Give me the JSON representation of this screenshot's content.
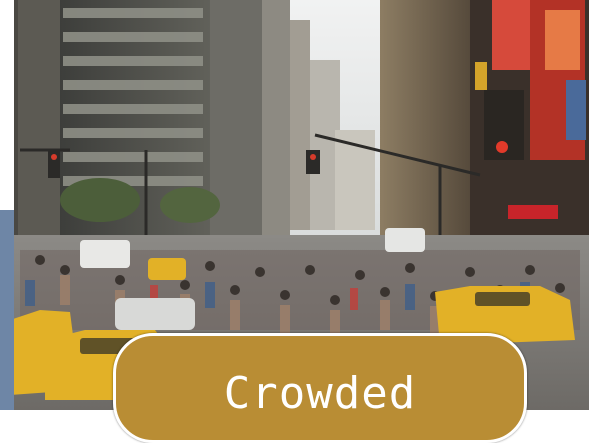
{
  "photo": {
    "subject": "crowded-city-street-photo"
  },
  "caption": {
    "text": "Crowded",
    "background_color": "#b98d34",
    "text_color": "#ffffff"
  }
}
